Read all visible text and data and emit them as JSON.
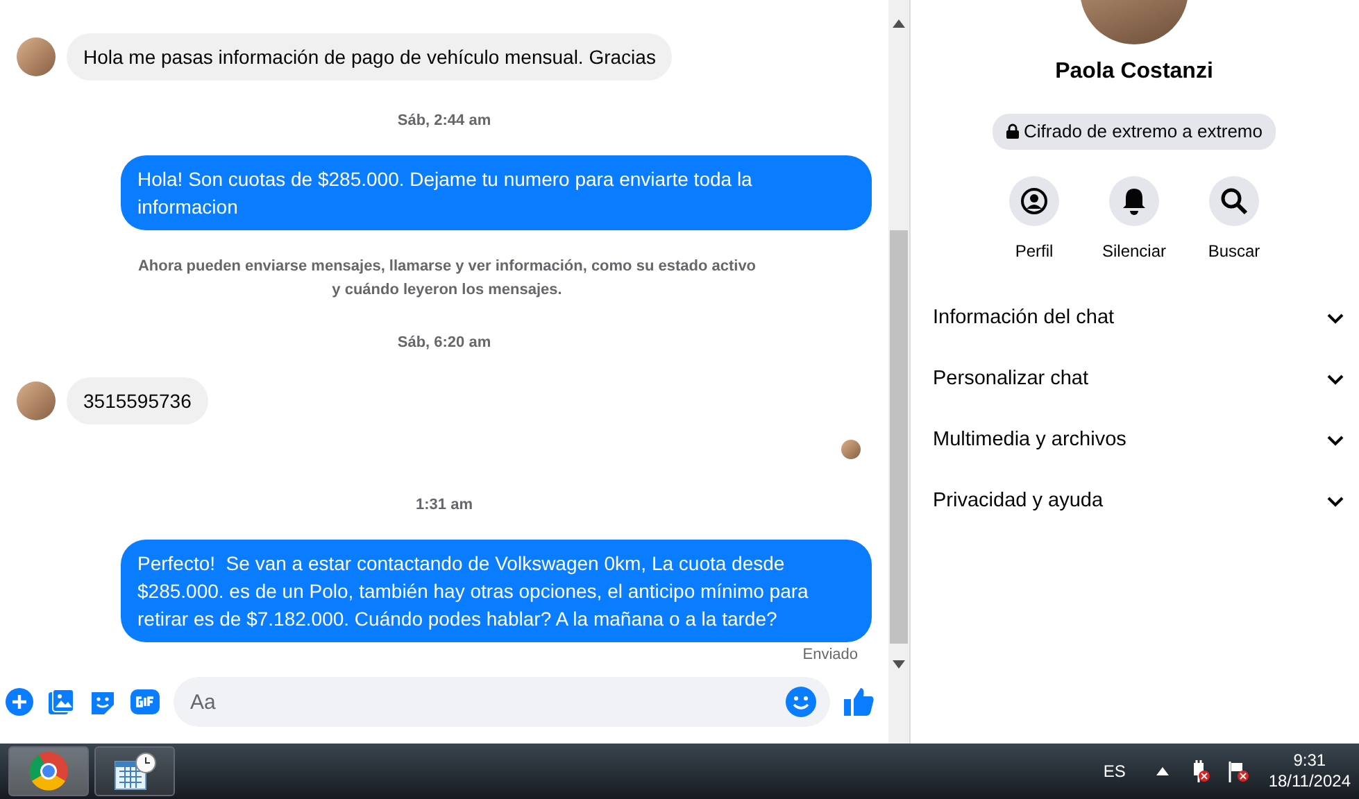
{
  "messages": [
    {
      "kind": "incoming",
      "text": "Hola me pasas información de pago de vehículo mensual. Gracias"
    },
    {
      "kind": "timestamp",
      "text": "Sáb, 2:44 am"
    },
    {
      "kind": "outgoing",
      "text": "Hola! Son cuotas de $285.000. Dejame tu numero para enviarte toda la informacion"
    },
    {
      "kind": "notice",
      "text": "Ahora pueden enviarse mensajes, llamarse y ver información, como su estado activo y cuándo leyeron los mensajes."
    },
    {
      "kind": "timestamp",
      "text": "Sáb, 6:20 am"
    },
    {
      "kind": "incoming",
      "text": "3515595736"
    },
    {
      "kind": "read_receipt"
    },
    {
      "kind": "timestamp",
      "text": "1:31 am"
    },
    {
      "kind": "outgoing",
      "text": "Perfecto!  Se van a estar contactando de Volkswagen 0km, La cuota desde $285.000. es de un Polo, también hay otras opciones, el anticipo mínimo para retirar es de $7.182.000. Cuándo podes hablar? A la mañana o a la tarde?"
    },
    {
      "kind": "status",
      "text": "Enviado"
    }
  ],
  "composer": {
    "placeholder": "Aa"
  },
  "profile": {
    "name": "Paola Costanzi",
    "encryption": "Cifrado de extremo a extremo",
    "actions": [
      {
        "kind": "profile",
        "label": "Perfil"
      },
      {
        "kind": "mute",
        "label": "Silenciar"
      },
      {
        "kind": "search",
        "label": "Buscar"
      }
    ],
    "sections": [
      {
        "label": "Información del chat",
        "expanded": false
      },
      {
        "label": "Personalizar chat",
        "expanded": false
      },
      {
        "label": "Multimedia y archivos",
        "expanded": false
      },
      {
        "label": "Privacidad y ayuda",
        "expanded": false
      }
    ]
  },
  "taskbar": {
    "apps": [
      {
        "kind": "browser",
        "selected": true
      },
      {
        "kind": "calendar",
        "selected": false
      }
    ],
    "language": "ES",
    "time": "9:31",
    "date": "18/11/2024"
  }
}
